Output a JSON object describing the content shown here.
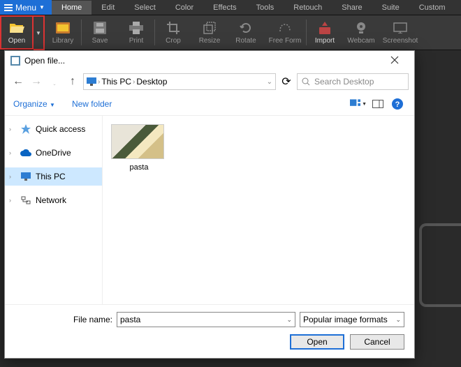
{
  "app": {
    "menu_label": "Menu"
  },
  "tabs": [
    "Home",
    "Edit",
    "Select",
    "Color",
    "Effects",
    "Tools",
    "Retouch",
    "Share",
    "Suite",
    "Custom"
  ],
  "ribbon": {
    "open": "Open",
    "library": "Library",
    "save": "Save",
    "print": "Print",
    "crop": "Crop",
    "resize": "Resize",
    "rotate": "Rotate",
    "freeform": "Free Form",
    "import": "Import",
    "webcam": "Webcam",
    "screenshot": "Screenshot"
  },
  "dialog": {
    "title": "Open file...",
    "path": {
      "seg1": "This PC",
      "seg2": "Desktop"
    },
    "search_placeholder": "Search Desktop",
    "organize": "Organize",
    "newfolder": "New folder",
    "nav": {
      "quick": "Quick access",
      "onedrive": "OneDrive",
      "thispc": "This PC",
      "network": "Network"
    },
    "file": {
      "name": "pasta"
    },
    "footer": {
      "filename_label": "File name:",
      "filename_value": "pasta",
      "filter": "Popular image formats",
      "open": "Open",
      "cancel": "Cancel"
    }
  }
}
